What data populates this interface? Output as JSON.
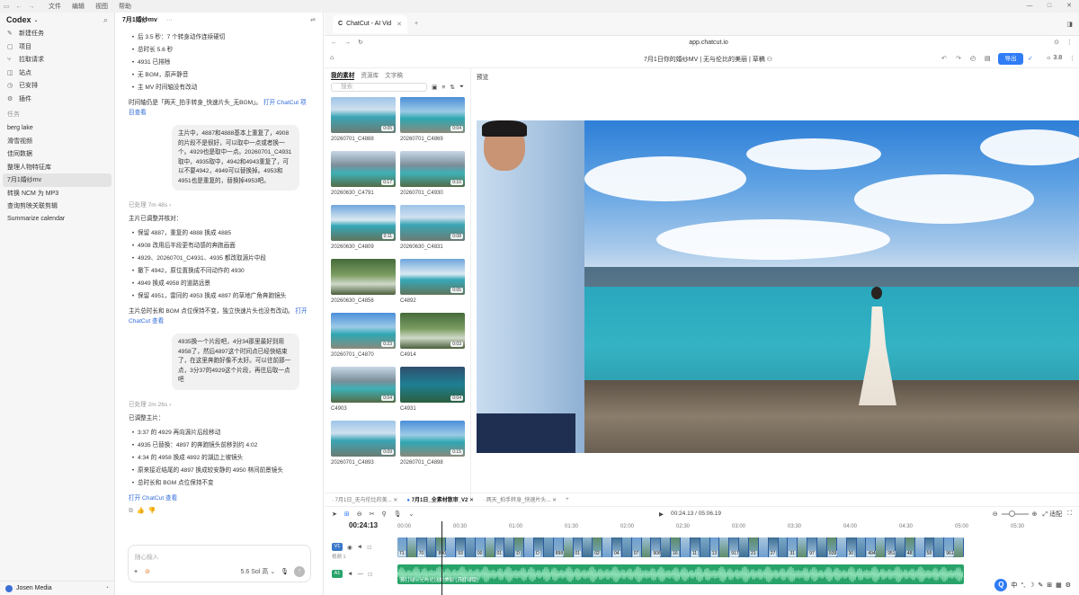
{
  "menubar": {
    "items": [
      "文件",
      "编辑",
      "视图",
      "帮助"
    ]
  },
  "sidebar": {
    "app_name": "Codex",
    "nav": [
      {
        "icon": "new-task-icon",
        "label": "新建任务"
      },
      {
        "icon": "project-icon",
        "label": "项目"
      },
      {
        "icon": "pull-request-icon",
        "label": "拉取请求"
      },
      {
        "icon": "site-icon",
        "label": "站点"
      },
      {
        "icon": "scheduled-icon",
        "label": "已安排"
      },
      {
        "icon": "plugin-icon",
        "label": "插件"
      }
    ],
    "section_title": "任务",
    "tasks": [
      "berg lake",
      "滑雪视频",
      "佳同数据",
      "整理人物特征库",
      "7月1婚纱mv",
      "转换 NCM 为 MP3",
      "查询剪映关联剪辑",
      "Summarize calendar"
    ],
    "selected_task": "7月1婚纱mv",
    "user": "Josen Media"
  },
  "chat": {
    "title": "7月1婚纱mv",
    "list1": [
      "后 3.5 秒：7 个转身动作连续硬切",
      "总时长 5.6 秒",
      "4931 已排除",
      "无 BGM，原声静音",
      "主 MV 时间轴没有改动"
    ],
    "p1": "时间轴仍是「两天_拍手转身_快速片头_无BGM」。",
    "p1_link": "打开 ChatCut 项目查看",
    "user_msg1": "主片中，4887和4888基本上重复了，4908的片段不是很好，可以取中一点或者换一个。4929也是取中一点。20260701_C4931取中，4935取中，4942和4943重复了，可以不要4942，4949可以替换掉。4953和4951也是重复的，替换掉4953吧。",
    "processed1": "已处理 7m 48s",
    "p2": "主片已调整并核对：",
    "list2": [
      "保留 4887，重复的 4888 换成 4885",
      "4908 改用后半段更有动感的奔跑画面",
      "4929、20260701_C4931、4935 都改取源片中段",
      "撤下 4942，原位置换成不同动作的 4930",
      "4949 换成 4958 的道路远景",
      "保留 4951，雷同的 4953 换成 4897 的草地广角奔跑镜头"
    ],
    "p3": "主片总时长和 BGM 点位保持不变，独立快速片头也没有改动。",
    "p3_link": "打开 ChatCut 查看",
    "user_msg2": "4935换一个片段吧，4分34那里最好到用4958了，然后4897这个时间点已经快结束了，在这里奔跑好像不太好。可以往前那一点，3分37的4929这个片段，再往后取一点吧",
    "processed2": "已处理 2m 26s",
    "p4": "已调整主片：",
    "list3": [
      "3:37 的 4929 再向源片后段移动",
      "4935 已替换：4897 的奔跑镜头前移到约 4:02",
      "4:34 的 4958 换成 4892 的湖边上坡镜头",
      "原来接近结尾的 4897 换成较安静的 4950 林间前景镜头",
      "总时长和 BGM 点位保持不变"
    ],
    "p5_link": "打开 ChatCut 查看",
    "composer_placeholder": "随心输入",
    "model": "5.6 Sol 高"
  },
  "browser": {
    "tab_title": "ChatCut - AI Vid",
    "url": "app.chatcut.io",
    "project_title": "7月1日你的婚纱MV | 无与伦比的美丽 | 草稿",
    "export_label": "导出",
    "credits": "3.8"
  },
  "media": {
    "tabs": [
      "我的素材",
      "资源库",
      "文字稿"
    ],
    "active_tab": "我的素材",
    "search_placeholder": "搜索",
    "clips": [
      {
        "name": "20260701_C4888",
        "dur": "0:05",
        "style": "th-a"
      },
      {
        "name": "20260701_C4869",
        "dur": "0:04",
        "style": "th-b"
      },
      {
        "name": "20260630_C4791",
        "dur": "0:17",
        "style": "th-c"
      },
      {
        "name": "20260701_C4930",
        "dur": "0:10",
        "style": "th-c"
      },
      {
        "name": "20260630_C4809",
        "dur": "0:11",
        "style": "th-d"
      },
      {
        "name": "20260630_C4831",
        "dur": "0:08",
        "style": "th-a"
      },
      {
        "name": "20260630_C4856",
        "dur": "",
        "style": "th-e"
      },
      {
        "name": "C4892",
        "dur": "0:05",
        "style": "th-d"
      },
      {
        "name": "20260701_C4870",
        "dur": "0:23",
        "style": "th-b"
      },
      {
        "name": "C4914",
        "dur": "0:03",
        "style": "th-e"
      },
      {
        "name": "C4903",
        "dur": "0:04",
        "style": "th-c"
      },
      {
        "name": "C4931",
        "dur": "0:04",
        "style": "th-f"
      },
      {
        "name": "20260701_C4893",
        "dur": "0:09",
        "style": "th-a"
      },
      {
        "name": "20260701_C4898",
        "dur": "0:15",
        "style": "th-b"
      }
    ]
  },
  "preview": {
    "label": "预览"
  },
  "timeline": {
    "tabs": [
      "7月1日_无与伦比的美...",
      "7月1日_全素材散审_V2",
      "两天_拍手转身_快速片头..."
    ],
    "active_tab": "7月1日_全素材散审_V2",
    "timecode": "00:24:13",
    "position": "00:24.13 / 05:06.19",
    "ruler": [
      "00:00",
      "00:30",
      "01:00",
      "01:30",
      "02:00",
      "02:30",
      "03:00",
      "03:30",
      "04:00",
      "04:30",
      "05:00",
      "05:30"
    ],
    "video_track_tag": "V1",
    "video_track_name": "视频 1",
    "audio_track_tag": "A1",
    "clip_numbers": [
      "71",
      "70",
      "890",
      "93",
      "00",
      "01",
      "D",
      "D",
      "898",
      "01",
      "02",
      "04",
      "07",
      "908",
      "16",
      "11",
      "13",
      "917",
      "21",
      "27",
      "31",
      "97",
      "939",
      "30",
      "4943",
      "951",
      "48",
      "58",
      "961"
    ],
    "audio_label": "苏打绿 - 无与伦比的美丽 (苏打绿版)",
    "zoom_label": "适配"
  },
  "ime": {
    "items": [
      "中",
      "°,",
      "☽",
      "✎",
      "⊞",
      "▦",
      "⚙"
    ]
  }
}
